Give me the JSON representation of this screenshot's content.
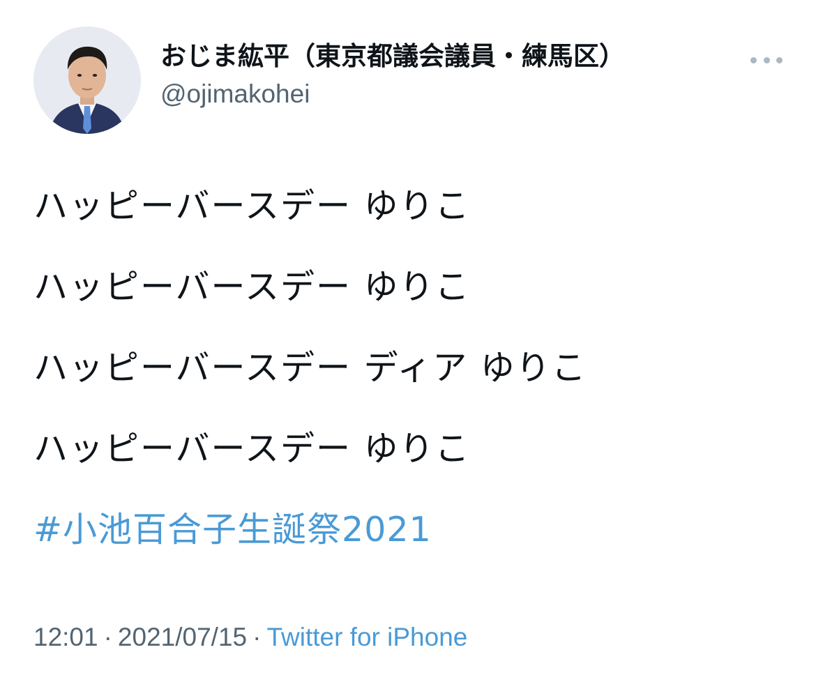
{
  "author": {
    "display_name": "おじま紘平（東京都議会議員・練馬区）",
    "handle": "@ojimakohei",
    "avatar_icon": "profile-photo-avatar"
  },
  "more_icon": "more-dots-icon",
  "tweet": {
    "lines": [
      "ハッピーバースデー ゆりこ",
      "ハッピーバースデー ゆりこ",
      "ハッピーバースデー ディア ゆりこ",
      "ハッピーバースデー ゆりこ"
    ],
    "hashtag": "#小池百合子生誕祭2021"
  },
  "footer": {
    "time": "12:01",
    "separator": "·",
    "date": "2021/07/15",
    "source": "Twitter for iPhone"
  },
  "colors": {
    "text": "#0f1419",
    "secondary": "#536471",
    "link": "#4a9ad6",
    "background": "#ffffff"
  }
}
